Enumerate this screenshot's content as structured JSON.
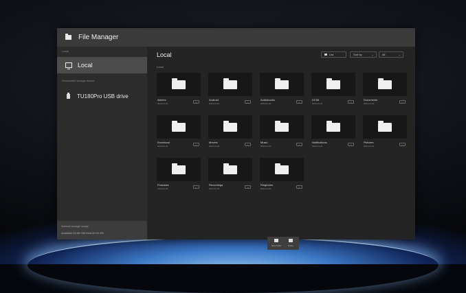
{
  "window": {
    "title": "File Manager"
  },
  "sidebar": {
    "local_caption": "Local",
    "local_label": "Local",
    "removable_caption": "Removable storage device",
    "usb_label": "TU180Pro USB drive",
    "storage_caption": "Internal storage usage",
    "storage_text": "Available:28.58 GB/Total:32.00 GB"
  },
  "main": {
    "title": "Local",
    "path": "Local",
    "view_label": "List",
    "sort_label": "Sort by",
    "filter_label": "All",
    "folders": [
      {
        "name": "Alarms",
        "date": "2024-01-01"
      },
      {
        "name": "Android",
        "date": "2024-01-01"
      },
      {
        "name": "Audiobooks",
        "date": "2024-01-01"
      },
      {
        "name": "DCIM",
        "date": "2024-01-01"
      },
      {
        "name": "Documents",
        "date": "2024-01-01"
      },
      {
        "name": "Download",
        "date": "2024-01-01"
      },
      {
        "name": "Movies",
        "date": "2024-01-01"
      },
      {
        "name": "Music",
        "date": "2024-01-01"
      },
      {
        "name": "Notifications",
        "date": "2024-01-01"
      },
      {
        "name": "Pictures",
        "date": "2024-01-01"
      },
      {
        "name": "Podcasts",
        "date": "2024-01-01"
      },
      {
        "name": "Recordings",
        "date": "2024-01-01"
      },
      {
        "name": "Ringtones",
        "date": "2024-01-01"
      }
    ],
    "more_label": "...",
    "new_folder_label": "New folder",
    "paste_label": "Paste"
  },
  "icons": {
    "title": "folder-icon",
    "local": "monitor-icon",
    "usb": "usb-drive-icon",
    "view": "list-view-icon"
  },
  "colors": {
    "window_bg": "#242424",
    "titlebar_bg": "#3a3a3a",
    "sidebar_bg": "#2c2c2c",
    "selected_bg": "#4c4c4c",
    "thumb_bg": "#171717"
  }
}
